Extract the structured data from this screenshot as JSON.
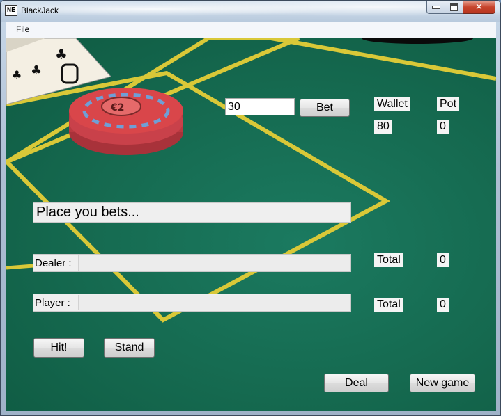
{
  "window": {
    "title": "BlackJack",
    "app_icon": "NE"
  },
  "menu": {
    "file": "File"
  },
  "bet": {
    "amount": "30",
    "button": "Bet"
  },
  "wallet": {
    "label": "Wallet",
    "value": "80"
  },
  "pot": {
    "label": "Pot",
    "value": "0"
  },
  "status": "Place you bets...",
  "dealer": {
    "label": "Dealer :",
    "total_label": "Total",
    "total_value": "0"
  },
  "player": {
    "label": "Player :",
    "total_label": "Total",
    "total_value": "0"
  },
  "buttons": {
    "hit": "Hit!",
    "stand": "Stand",
    "deal": "Deal",
    "new_game": "New game"
  },
  "colors": {
    "felt": "#15694f",
    "table_line": "#d9c838",
    "chip": "#d9464a"
  }
}
